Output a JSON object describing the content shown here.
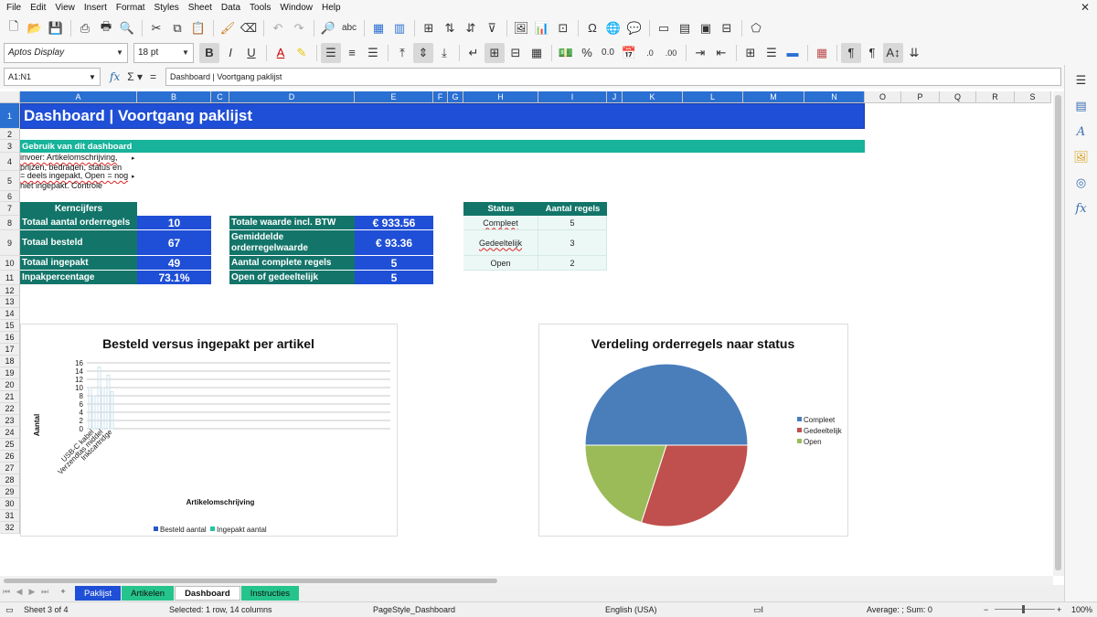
{
  "menu": [
    "File",
    "Edit",
    "View",
    "Insert",
    "Format",
    "Styles",
    "Sheet",
    "Data",
    "Tools",
    "Window",
    "Help"
  ],
  "toolbar": {
    "font_name": "Aptos Display",
    "font_size": "18 pt"
  },
  "formula_bar": {
    "cell_ref": "A1:N1",
    "content": "Dashboard | Voortgang paklijst"
  },
  "columns": [
    "A",
    "B",
    "C",
    "D",
    "E",
    "F",
    "G",
    "H",
    "I",
    "J",
    "K",
    "L",
    "M",
    "N",
    "O",
    "P",
    "Q",
    "R",
    "S"
  ],
  "rows": [
    "1",
    "2",
    "3",
    "4",
    "5",
    "6",
    "7",
    "8",
    "9",
    "10",
    "11",
    "12",
    "13",
    "14",
    "15",
    "16",
    "17",
    "18",
    "19",
    "20",
    "21",
    "22",
    "23",
    "24",
    "25",
    "26",
    "27",
    "28",
    "29",
    "30",
    "31",
    "32"
  ],
  "sheet": {
    "title": "Dashboard | Voortgang paklijst",
    "usage_header": "Gebruik van dit dashboard",
    "usage_line4": "invoer: Artikelomschrijving, prijzen, bedragen, status en",
    "usage_line5": "= deels ingepakt, Open = nog niet ingepakt. Controle",
    "kpi_header": "Kerncijfers",
    "kpis_left": [
      {
        "label": "Totaal aantal orderregels",
        "value": "10"
      },
      {
        "label": "Totaal besteld",
        "value": "67"
      },
      {
        "label": "Totaal ingepakt",
        "value": "49"
      },
      {
        "label": "Inpakpercentage",
        "value": "73.1%"
      }
    ],
    "kpis_right": [
      {
        "label": "Totale waarde incl. BTW",
        "value": "€ 933.56"
      },
      {
        "label": "Gemiddelde orderregelwaarde",
        "value": "€ 93.36"
      },
      {
        "label": "Aantal complete regels",
        "value": "5"
      },
      {
        "label": "Open of gedeeltelijk",
        "value": "5"
      }
    ],
    "status_table": {
      "headers": [
        "Status",
        "Aantal regels"
      ],
      "rows": [
        {
          "status": "Compleet",
          "count": "5"
        },
        {
          "status": "Gedeeltelijk",
          "count": "3"
        },
        {
          "status": "Open",
          "count": "2"
        }
      ]
    }
  },
  "chart_data": [
    {
      "type": "bar",
      "title": "Besteld versus ingepakt per artikel",
      "xlabel": "Artikelomschrijving",
      "ylabel": "Aantal",
      "ylim": [
        0,
        16
      ],
      "yticks": [
        0,
        2,
        4,
        6,
        8,
        10,
        12,
        14,
        16
      ],
      "categories": [
        "USB-C kabel",
        "Verzendtas middel",
        "Inktcartridge"
      ],
      "series": [
        {
          "name": "Besteld aantal",
          "color": "#2a55c8",
          "values": [
            10,
            15,
            13
          ]
        },
        {
          "name": "Ingepakt aantal",
          "color": "#25c3a3",
          "values": [
            8,
            10,
            9
          ]
        }
      ],
      "legend": "bottom",
      "grid": true
    },
    {
      "type": "pie",
      "title": "Verdeling orderregels naar status",
      "categories": [
        "Compleet",
        "Gedeeltelijk",
        "Open"
      ],
      "values": [
        5,
        3,
        2
      ],
      "colors": [
        "#4a7ebb",
        "#c0504d",
        "#9bbb59"
      ],
      "legend": "right"
    }
  ],
  "tabs": [
    {
      "label": "Paklijst",
      "bg": "#1f4fd6",
      "fg": "#ffffff"
    },
    {
      "label": "Artikelen",
      "bg": "#25c48d",
      "fg": "#111111"
    },
    {
      "label": "Dashboard",
      "bg": "#ffffff",
      "fg": "#111111"
    },
    {
      "label": "Instructies",
      "bg": "#25c48d",
      "fg": "#111111"
    }
  ],
  "status_bar": {
    "sheet": "Sheet 3 of 4",
    "selection": "Selected: 1 row, 14 columns",
    "page_style": "PageStyle_Dashboard",
    "language": "English (USA)",
    "summary": "Average: ; Sum: 0",
    "zoom": "100%"
  }
}
